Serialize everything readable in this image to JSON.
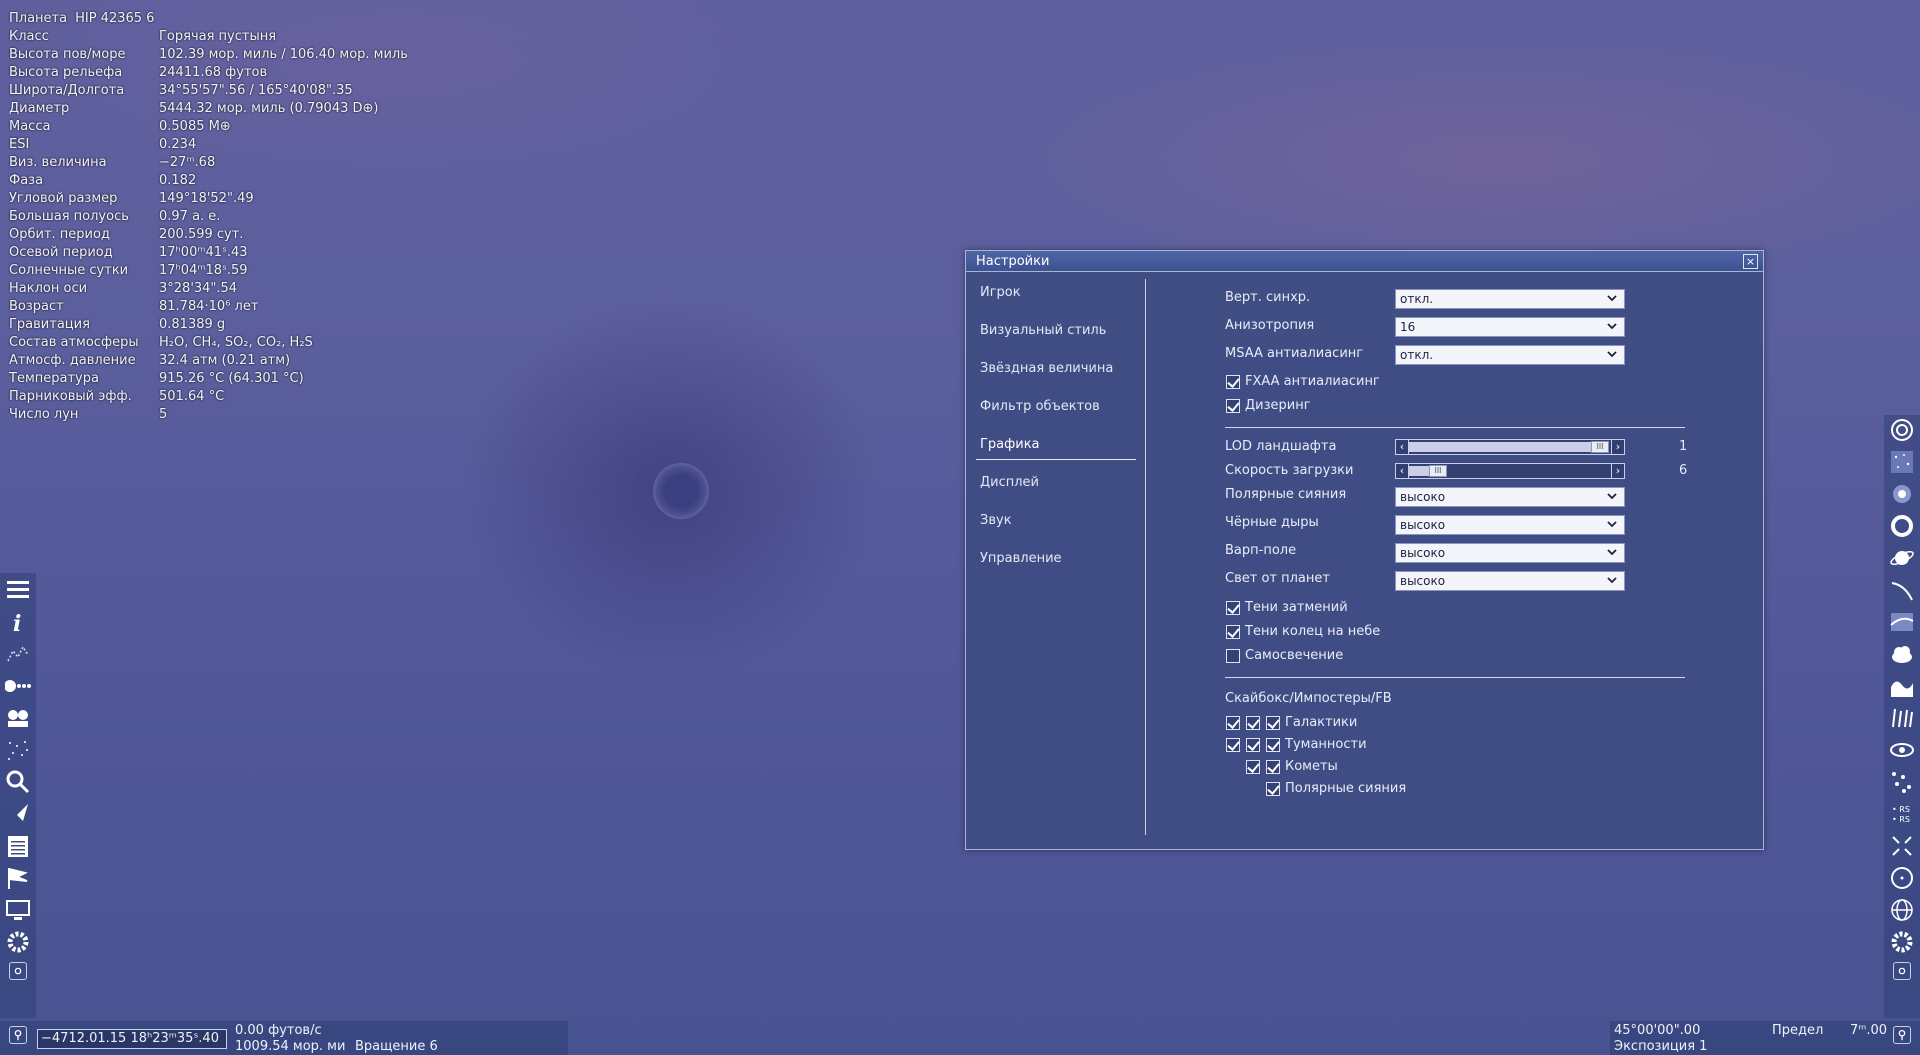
{
  "info": {
    "object_kind": "Планета",
    "object_name": "HIP 42365 6",
    "rows": [
      {
        "key": "Класс",
        "value": "Горячая пустыня"
      },
      {
        "key": "Высота пов/море",
        "value": "102.39 мор. миль / 106.40 мор. миль"
      },
      {
        "key": "Высота рельефа",
        "value": "24411.68 футов"
      },
      {
        "key": "Широта/Долгота",
        "value": "34°55'57\".56 / 165°40'08\".35"
      },
      {
        "key": "Диаметр",
        "value": "5444.32 мор. миль (0.79043 D⊕)"
      },
      {
        "key": "Масса",
        "value": "0.5085 M⊕"
      },
      {
        "key": "ESI",
        "value": "0.234"
      },
      {
        "key": "Виз. величина",
        "value": "−27ᵐ.68"
      },
      {
        "key": "Фаза",
        "value": "0.182"
      },
      {
        "key": "Угловой размер",
        "value": "149°18'52\".49"
      },
      {
        "key": "Большая полуось",
        "value": "0.97 а. е."
      },
      {
        "key": "Орбит. период",
        "value": "200.599 сут."
      },
      {
        "key": "Осевой период",
        "value": "17ʰ00ᵐ41ˢ.43"
      },
      {
        "key": "Солнечные сутки",
        "value": "17ʰ04ᵐ18ˢ.59"
      },
      {
        "key": "Наклон оси",
        "value": "3°28'34\".54"
      },
      {
        "key": "Возраст",
        "value": "81.784·10⁶ лет"
      },
      {
        "key": "Гравитация",
        "value": "0.81389 g"
      },
      {
        "key": "Состав атмосферы",
        "value": "H₂O, CH₄, SO₂, CO₂, H₂S"
      },
      {
        "key": "Атмосф. давление",
        "value": "32.4 атм (0.21 атм)"
      },
      {
        "key": "Температура",
        "value": "915.26 °C (64.301 °C)"
      },
      {
        "key": "Парниковый эфф.",
        "value": "501.64 °C"
      },
      {
        "key": "Число лун",
        "value": "5"
      }
    ]
  },
  "settings": {
    "title": "Настройки",
    "close_label": "×",
    "nav": [
      "Игрок",
      "Визуальный стиль",
      "Звёздная величина",
      "Фильтр объектов",
      "Графика",
      "Дисплей",
      "Звук",
      "Управление"
    ],
    "active_nav": "Графика",
    "vsync": {
      "label": "Верт. синхр.",
      "value": "откл."
    },
    "anisotropy": {
      "label": "Анизотропия",
      "value": "16"
    },
    "msaa": {
      "label": "MSAA антиалиасинг",
      "value": "откл."
    },
    "fxaa": {
      "label": "FXAA антиалиасинг",
      "checked": true
    },
    "dithering": {
      "label": "Дизеринг",
      "checked": true
    },
    "lod": {
      "label": "LOD ландшафта",
      "value": "1",
      "position": 1.0
    },
    "load_speed": {
      "label": "Скорость загрузки",
      "value": "6",
      "position": 0.1
    },
    "aurora": {
      "label": "Полярные сияния",
      "value": "высоко"
    },
    "black_holes": {
      "label": "Чёрные дыры",
      "value": "высоко"
    },
    "warp": {
      "label": "Варп-поле",
      "value": "высоко"
    },
    "planet_light": {
      "label": "Свет от планет",
      "value": "высоко"
    },
    "eclipse_shadows": {
      "label": "Тени затмений",
      "checked": true
    },
    "ring_shadows": {
      "label": "Тени колец на небе",
      "checked": true
    },
    "self_shadow": {
      "label": "Самосвечение",
      "checked": false
    },
    "skybox_header": "Скайбокс/Импостеры/FB",
    "skybox_rows": [
      {
        "label": "Галактики",
        "checks": [
          true,
          true,
          true
        ]
      },
      {
        "label": "Туманности",
        "checks": [
          true,
          true,
          true
        ]
      },
      {
        "label": "Кометы",
        "checks": [
          true,
          true
        ]
      },
      {
        "label": "Полярные сияния",
        "checks": [
          true
        ]
      }
    ]
  },
  "left_toolbar": [
    "menu-icon",
    "info-icon",
    "constellation-icon",
    "comet-icon",
    "faces-icon",
    "stars-icon",
    "search-icon",
    "ship-icon",
    "notepad-icon",
    "flags-icon",
    "monitor-icon",
    "gear-icon",
    "screenshot-icon"
  ],
  "right_toolbar": [
    "spiral-galaxy-icon",
    "star-field-icon",
    "nebula-icon",
    "ring-nebula-icon",
    "planet-icon",
    "orbit-icon",
    "terrain-icon",
    "clouds-icon",
    "water-icon",
    "aurora-icon",
    "eye-icon",
    "points-icon",
    "rs-icon",
    "collapse-icon",
    "circle-icon",
    "globe-icon",
    "gear-icon",
    "screenshot-icon"
  ],
  "bottom": {
    "date": "−4712.01.15 18ʰ23ᵐ35ˢ.40",
    "speed": "0.00 футов/с",
    "distance": "1009.54 мор. ми",
    "rotation": "Вращение 6",
    "fov": "45°00'00\".00",
    "exposure": "Экспозиция 1",
    "limit_label": "Предел",
    "limit_value": "7ᵐ.00"
  },
  "colors": {
    "window_bg": "#3e4c82",
    "title_bar": "#4e65a6",
    "select_bg": "#f4f5fa"
  }
}
